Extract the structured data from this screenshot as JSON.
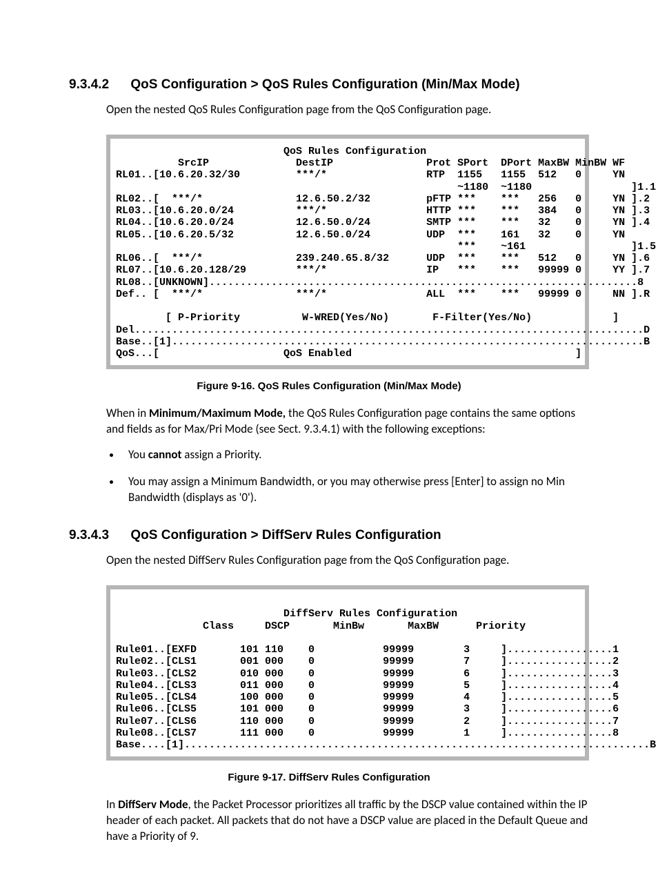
{
  "section1": {
    "number": "9.3.4.2",
    "title": "QoS Configuration > QoS Rules Configuration (Min/Max Mode)",
    "intro": "Open the nested QoS Rules Configuration page from the QoS Configuration page.",
    "caption": "Figure 9-16. QoS Rules Configuration (Min/Max Mode)",
    "para1_a": "When in ",
    "para1_b": "Minimum/Maximum Mode,",
    "para1_c": " the QoS Rules Configuration page contains the same options and fields as for Max/Pri Mode (see Sect. 9.3.4.1) with the following exceptions:",
    "bullet1_a": "You ",
    "bullet1_b": "cannot",
    "bullet1_c": " assign a Priority.",
    "bullet2": "You may assign a Minimum Bandwidth, or you may otherwise press [Enter] to assign no Min Bandwidth (displays as '0')."
  },
  "qos_terminal": {
    "title": "QoS Rules Configuration",
    "headers": [
      "SrcIP",
      "DestIP",
      "Prot",
      "SPort",
      "DPort",
      "MaxBW",
      "MinBW",
      "WF"
    ],
    "rules": [
      {
        "id": "RL01",
        "src": "[10.6.20.32/30",
        "dst": "***/*",
        "prot": "RTP",
        "sport": "1155",
        "dport": "1155",
        "maxbw": "512",
        "minbw": "0",
        "wf": "YN",
        "idx": "1.1",
        "sport2": "~1180",
        "dport2": "~1180"
      },
      {
        "id": "RL02",
        "src": "[  ***/*",
        "dst": "12.6.50.2/32",
        "prot": "pFTP",
        "sport": "***",
        "dport": "***",
        "maxbw": "256",
        "minbw": "0",
        "wf": "YN",
        "idx": ".2"
      },
      {
        "id": "RL03",
        "src": "[10.6.20.0/24",
        "dst": "***/*",
        "prot": "HTTP",
        "sport": "***",
        "dport": "***",
        "maxbw": "384",
        "minbw": "0",
        "wf": "YN",
        "idx": ".3"
      },
      {
        "id": "RL04",
        "src": "[10.6.20.0/24",
        "dst": "12.6.50.0/24",
        "prot": "SMTP",
        "sport": "***",
        "dport": "***",
        "maxbw": "32",
        "minbw": "0",
        "wf": "YN",
        "idx": ".4"
      },
      {
        "id": "RL05",
        "src": "[10.6.20.5/32",
        "dst": "12.6.50.0/24",
        "prot": "UDP",
        "sport": "***",
        "dport": "161",
        "maxbw": "32",
        "minbw": "0",
        "wf": "YN",
        "idx": "1.5",
        "sport2": "***",
        "dport2": "~161"
      },
      {
        "id": "RL06",
        "src": "[  ***/*",
        "dst": "239.240.65.8/32",
        "prot": "UDP",
        "sport": "***",
        "dport": "***",
        "maxbw": "512",
        "minbw": "0",
        "wf": "YN",
        "idx": ".6"
      },
      {
        "id": "RL07",
        "src": "[10.6.20.128/29",
        "dst": "***/*",
        "prot": "IP",
        "sport": "***",
        "dport": "***",
        "maxbw": "99999",
        "minbw": "0",
        "wf": "YY",
        "idx": ".7"
      },
      {
        "id": "RL08",
        "src": "[UNKNOWN]",
        "dots": true,
        "idx": ".8"
      },
      {
        "id": "Def",
        "src": "[  ***/*",
        "dst": "***/*",
        "prot": "ALL",
        "sport": "***",
        "dport": "***",
        "maxbw": "99999",
        "minbw": "0",
        "wf": "NN",
        "idx": ".R"
      }
    ],
    "legend": "[ P-Priority          W-WRED(Yes/No)       F-Filter(Yes/No)             ]",
    "del": "Del..................................................................................D",
    "base": "Base..[1]............................................................................B",
    "qos": "QoS...[                    QoS Enabled                                    ]"
  },
  "section2": {
    "number": "9.3.4.3",
    "title": "QoS Configuration > DiffServ Rules Configuration",
    "intro": "Open the nested DiffServ Rules Configuration page from the QoS Configuration page.",
    "caption": "Figure 9-17. DiffServ Rules Configuration",
    "para1_a": "In ",
    "para1_b": "DiffServ Mode",
    "para1_c": ", the Packet Processor prioritizes all traffic by the DSCP value contained within the IP header of each packet. All packets that do not have a DSCP value are placed in the Default Queue and have a Priority of 9."
  },
  "diffserv_terminal": {
    "title": "DiffServ Rules Configuration",
    "headers": [
      "Class",
      "DSCP",
      "MinBw",
      "MaxBW",
      "Priority"
    ],
    "rules": [
      {
        "id": "Rule01",
        "class": "[EXFD",
        "dscp": "101 110",
        "minbw": "0",
        "maxbw": "99999",
        "pri": "3",
        "idx": "1"
      },
      {
        "id": "Rule02",
        "class": "[CLS1",
        "dscp": "001 000",
        "minbw": "0",
        "maxbw": "99999",
        "pri": "7",
        "idx": "2"
      },
      {
        "id": "Rule03",
        "class": "[CLS2",
        "dscp": "010 000",
        "minbw": "0",
        "maxbw": "99999",
        "pri": "6",
        "idx": "3"
      },
      {
        "id": "Rule04",
        "class": "[CLS3",
        "dscp": "011 000",
        "minbw": "0",
        "maxbw": "99999",
        "pri": "5",
        "idx": "4"
      },
      {
        "id": "Rule05",
        "class": "[CLS4",
        "dscp": "100 000",
        "minbw": "0",
        "maxbw": "99999",
        "pri": "4",
        "idx": "5"
      },
      {
        "id": "Rule06",
        "class": "[CLS5",
        "dscp": "101 000",
        "minbw": "0",
        "maxbw": "99999",
        "pri": "3",
        "idx": "6"
      },
      {
        "id": "Rule07",
        "class": "[CLS6",
        "dscp": "110 000",
        "minbw": "0",
        "maxbw": "99999",
        "pri": "2",
        "idx": "7"
      },
      {
        "id": "Rule08",
        "class": "[CLS7",
        "dscp": "111 000",
        "minbw": "0",
        "maxbw": "99999",
        "pri": "1",
        "idx": "8"
      }
    ],
    "base": "Base....[1]...........................................................................B"
  },
  "chart_data": [
    {
      "type": "table",
      "title": "QoS Rules Configuration",
      "columns": [
        "Rule",
        "SrcIP",
        "DestIP",
        "Prot",
        "SPort",
        "DPort",
        "MaxBW",
        "MinBW",
        "WF"
      ],
      "rows": [
        [
          "RL01",
          "10.6.20.32/30",
          "***/*",
          "RTP",
          "1155~1180",
          "1155~1180",
          512,
          0,
          "YN"
        ],
        [
          "RL02",
          "***/*",
          "12.6.50.2/32",
          "pFTP",
          "***",
          "***",
          256,
          0,
          "YN"
        ],
        [
          "RL03",
          "10.6.20.0/24",
          "***/*",
          "HTTP",
          "***",
          "***",
          384,
          0,
          "YN"
        ],
        [
          "RL04",
          "10.6.20.0/24",
          "12.6.50.0/24",
          "SMTP",
          "***",
          "***",
          32,
          0,
          "YN"
        ],
        [
          "RL05",
          "10.6.20.5/32",
          "12.6.50.0/24",
          "UDP",
          "***",
          "161~161",
          32,
          0,
          "YN"
        ],
        [
          "RL06",
          "***/*",
          "239.240.65.8/32",
          "UDP",
          "***",
          "***",
          512,
          0,
          "YN"
        ],
        [
          "RL07",
          "10.6.20.128/29",
          "***/*",
          "IP",
          "***",
          "***",
          99999,
          0,
          "YY"
        ],
        [
          "RL08",
          "UNKNOWN",
          "",
          "",
          "",
          "",
          "",
          "",
          ""
        ],
        [
          "Def",
          "***/*",
          "***/*",
          "ALL",
          "***",
          "***",
          99999,
          0,
          "NN"
        ]
      ]
    },
    {
      "type": "table",
      "title": "DiffServ Rules Configuration",
      "columns": [
        "Rule",
        "Class",
        "DSCP",
        "MinBw",
        "MaxBW",
        "Priority"
      ],
      "rows": [
        [
          "Rule01",
          "EXFD",
          "101 110",
          0,
          99999,
          3
        ],
        [
          "Rule02",
          "CLS1",
          "001 000",
          0,
          99999,
          7
        ],
        [
          "Rule03",
          "CLS2",
          "010 000",
          0,
          99999,
          6
        ],
        [
          "Rule04",
          "CLS3",
          "011 000",
          0,
          99999,
          5
        ],
        [
          "Rule05",
          "CLS4",
          "100 000",
          0,
          99999,
          4
        ],
        [
          "Rule06",
          "CLS5",
          "101 000",
          0,
          99999,
          3
        ],
        [
          "Rule07",
          "CLS6",
          "110 000",
          0,
          99999,
          2
        ],
        [
          "Rule08",
          "CLS7",
          "111 000",
          0,
          99999,
          1
        ]
      ]
    }
  ]
}
